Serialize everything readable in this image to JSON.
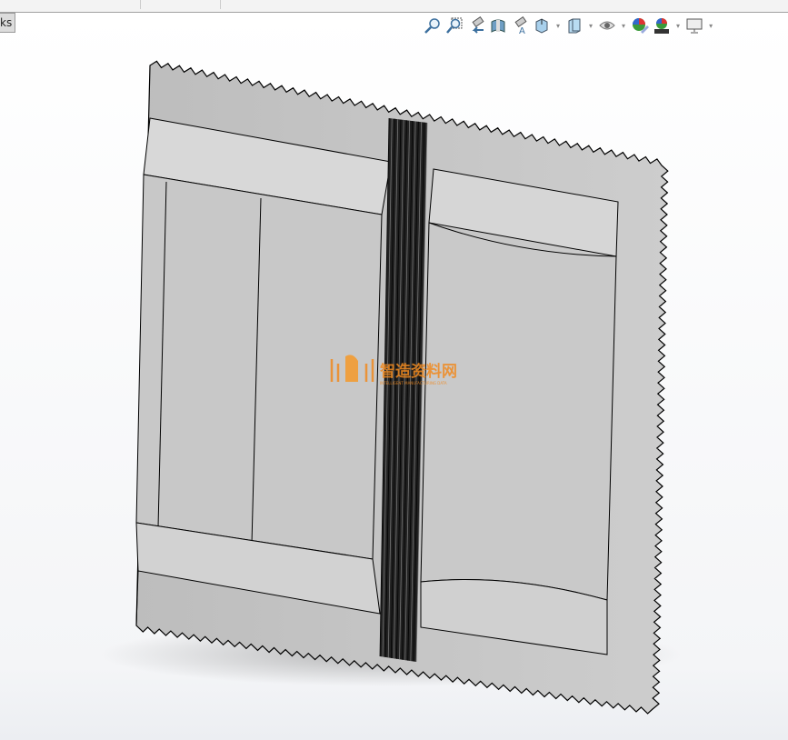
{
  "window": {
    "tab_label": "ks"
  },
  "heads_up_toolbar": {
    "icons": [
      "zoom-to-fit-icon",
      "zoom-to-area-icon",
      "previous-view-icon",
      "section-view-icon",
      "dynamic-annotation-view-icon",
      "view-orientation-icon",
      "display-style-icon",
      "hide-show-items-icon",
      "edit-appearance-icon",
      "apply-scene-icon",
      "view-settings-icon"
    ]
  },
  "watermark": {
    "text": "智造资料网",
    "subtext": "INTELLIGENT MANUFACTURING DATA"
  },
  "colors": {
    "sheet": "#c4c4c4",
    "band": "#d8d8d8",
    "strip": "#111111",
    "edge": "#000000"
  }
}
